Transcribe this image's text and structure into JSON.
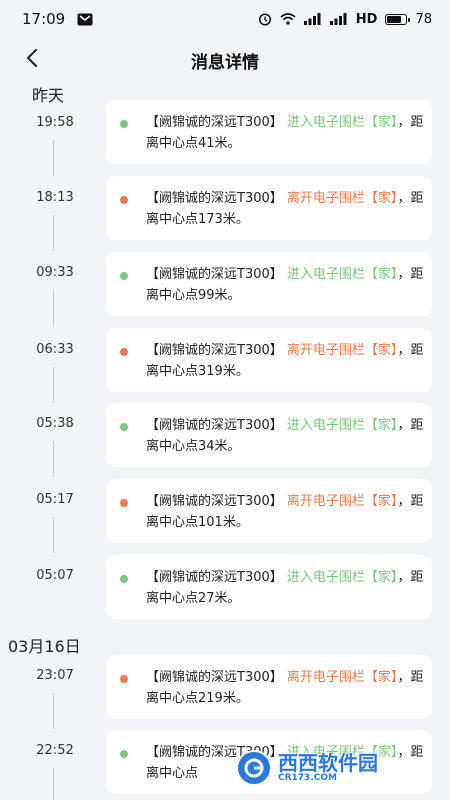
{
  "status": {
    "time": "17:09",
    "network": "HD",
    "battery": "78"
  },
  "header": {
    "title": "消息详情"
  },
  "groups": [
    {
      "date": "昨天",
      "items": [
        {
          "time": "19:58",
          "type": "enter",
          "device": "【阙锦诚的深远T300】",
          "action": "进入电子围栏",
          "fence": "【家】",
          "distance_text": "，距离中心点41米。"
        },
        {
          "time": "18:13",
          "type": "leave",
          "device": "【阙锦诚的深远T300】",
          "action": "离开电子围栏",
          "fence": "【家】",
          "distance_text": "，距离中心点173米。"
        },
        {
          "time": "09:33",
          "type": "enter",
          "device": "【阙锦诚的深远T300】",
          "action": "进入电子围栏",
          "fence": "【家】",
          "distance_text": "，距离中心点99米。"
        },
        {
          "time": "06:33",
          "type": "leave",
          "device": "【阙锦诚的深远T300】",
          "action": "离开电子围栏",
          "fence": "【家】",
          "distance_text": "，距离中心点319米。"
        },
        {
          "time": "05:38",
          "type": "enter",
          "device": "【阙锦诚的深远T300】",
          "action": "进入电子围栏",
          "fence": "【家】",
          "distance_text": "，距离中心点34米。"
        },
        {
          "time": "05:17",
          "type": "leave",
          "device": "【阙锦诚的深远T300】",
          "action": "离开电子围栏",
          "fence": "【家】",
          "distance_text": "，距离中心点101米。"
        },
        {
          "time": "05:07",
          "type": "enter",
          "device": "【阙锦诚的深远T300】",
          "action": "进入电子围栏",
          "fence": "【家】",
          "distance_text": "，距离中心点27米。"
        }
      ]
    },
    {
      "date": "03月16日",
      "items": [
        {
          "time": "23:07",
          "type": "leave",
          "device": "【阙锦诚的深远T300】",
          "action": "离开电子围栏",
          "fence": "【家】",
          "distance_text": "，距离中心点219米。"
        },
        {
          "time": "22:52",
          "type": "enter",
          "device": "【阙锦诚的深远T300】",
          "action": "进入电子围栏",
          "fence": "【家】",
          "distance_text": "，距离中心点"
        }
      ]
    }
  ],
  "colors": {
    "enter": "#7cc77e",
    "leave": "#ee7c4e",
    "background": "#f3f4f8"
  },
  "watermark": {
    "main": "西西软件园",
    "sub": "CR173.COM"
  }
}
